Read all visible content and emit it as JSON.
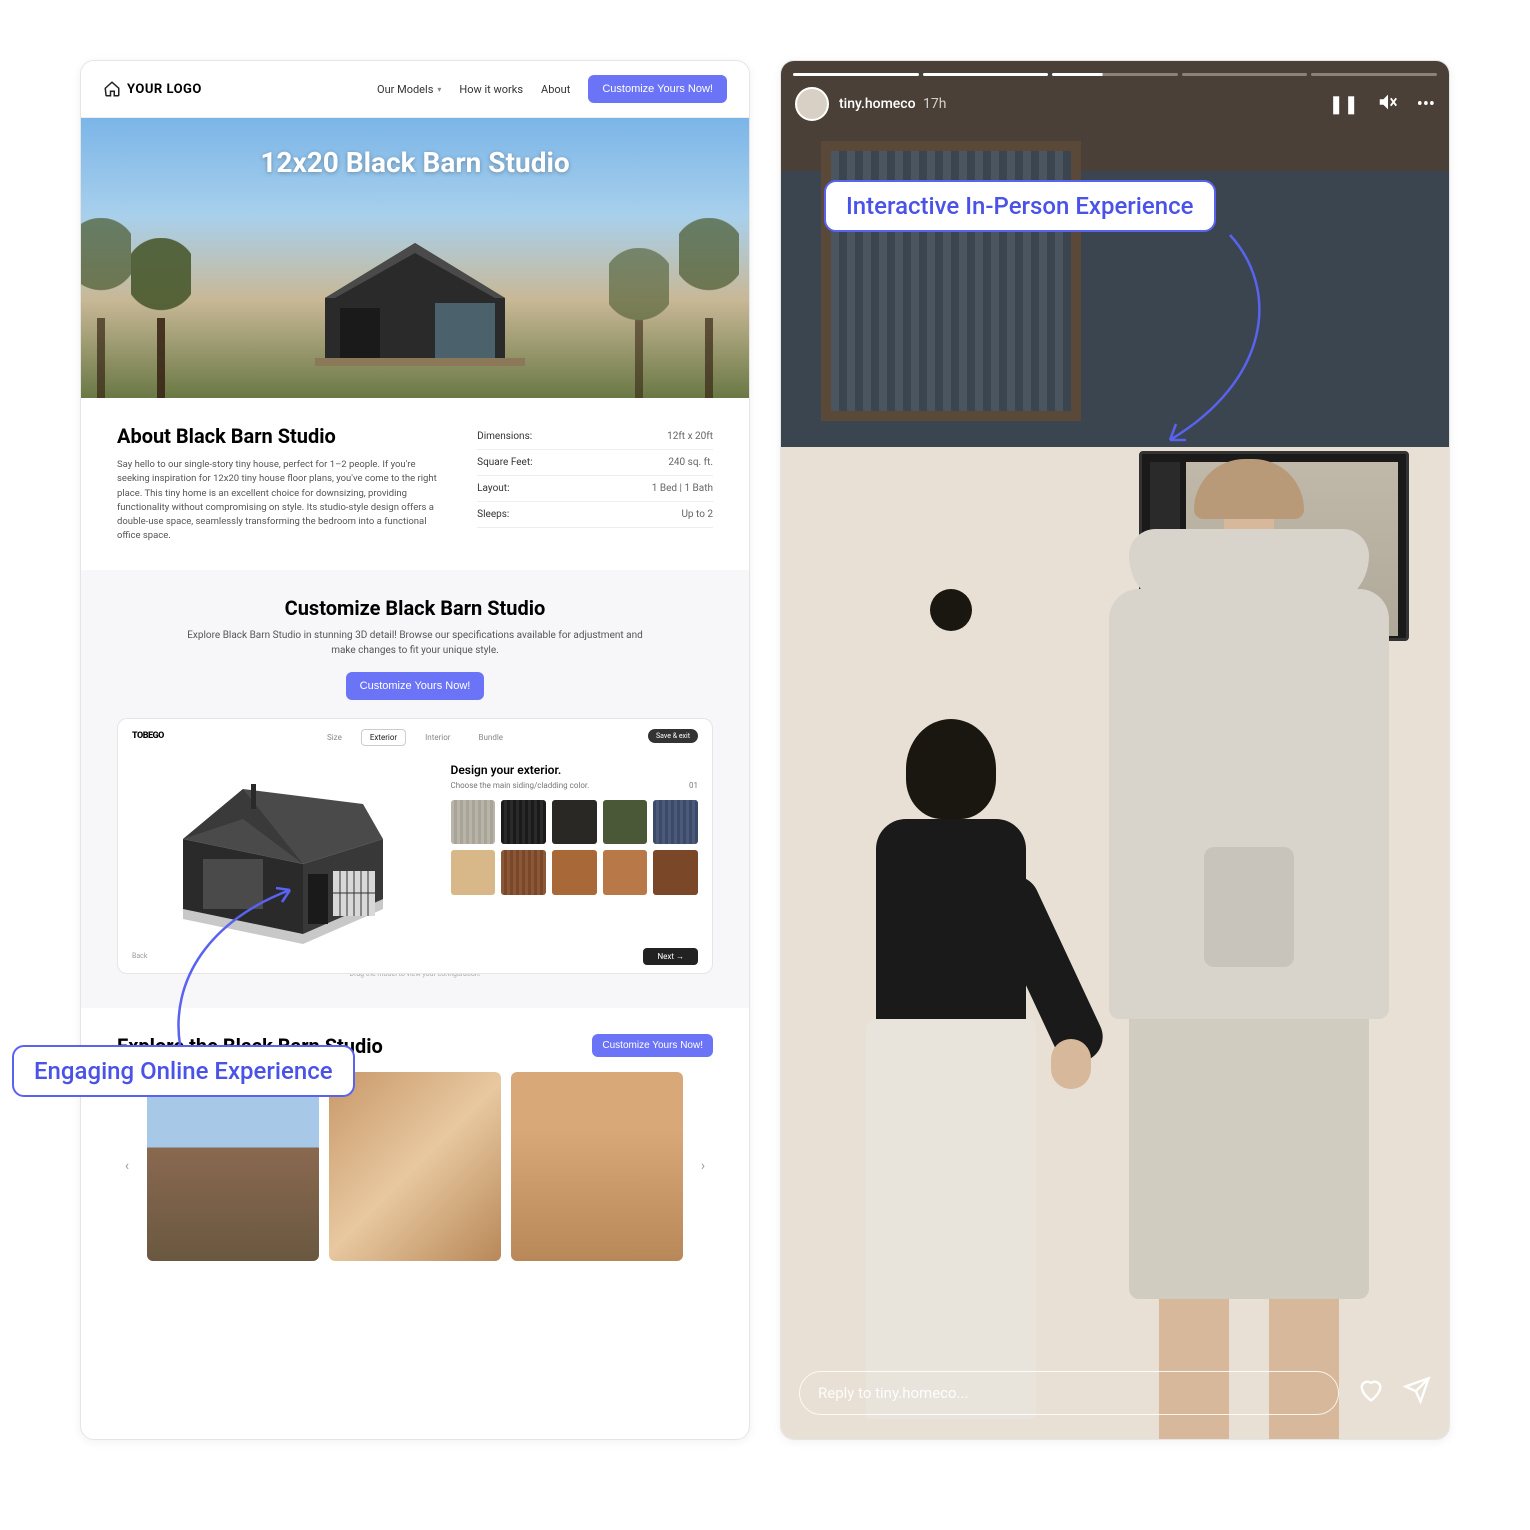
{
  "callouts": {
    "online": "Engaging Online Experience",
    "inperson": "Interactive In-Person Experience"
  },
  "site": {
    "logo_text": "YOUR LOGO",
    "nav": {
      "models": "Our Models",
      "how": "How it works",
      "about": "About"
    },
    "cta": "Customize Yours Now!",
    "hero_title": "12x20 Black Barn Studio",
    "about": {
      "heading": "About Black Barn Studio",
      "body": "Say hello to our single-story tiny house, perfect for 1–2 people. If you're seeking inspiration for 12x20 tiny house floor plans, you've come to the right place. This tiny home is an excellent choice for downsizing, providing functionality without compromising on style. Its studio-style design offers a double-use space, seamlessly transforming the bedroom into a functional office space."
    },
    "specs": [
      {
        "label": "Dimensions:",
        "value": "12ft x 20ft"
      },
      {
        "label": "Square Feet:",
        "value": "240 sq. ft."
      },
      {
        "label": "Layout:",
        "value": "1 Bed | 1 Bath"
      },
      {
        "label": "Sleeps:",
        "value": "Up to 2"
      }
    ],
    "customize": {
      "heading": "Customize Black Barn Studio",
      "sub": "Explore Black Barn Studio in stunning 3D detail! Browse our specifications available for adjustment and make changes to fit your unique style.",
      "cta": "Customize Yours Now!",
      "brand": "TOBEGO",
      "tabs": [
        "Size",
        "Exterior",
        "Interior",
        "Bundle"
      ],
      "active_tab": "Exterior",
      "save": "Save & exit",
      "panel_title": "Design your exterior.",
      "panel_sub": "Choose the main siding/cladding color.",
      "panel_step": "01",
      "swatches": [
        "#b8b4a8",
        "#1a1a1a",
        "#2a2825",
        "#4a5838",
        "#3a4a68",
        "#d8b888",
        "#8a5838",
        "#a86838",
        "#b87848",
        "#7a4828"
      ],
      "drag_hint": "Drag the model to view your configuration!",
      "back": "Back",
      "next": "Next"
    },
    "explore": {
      "heading": "Explore the Black Barn Studio",
      "cta": "Customize Yours Now!"
    }
  },
  "story": {
    "username": "tiny.homeco",
    "time": "17h",
    "reply_placeholder": "Reply to tiny.homeco..."
  }
}
